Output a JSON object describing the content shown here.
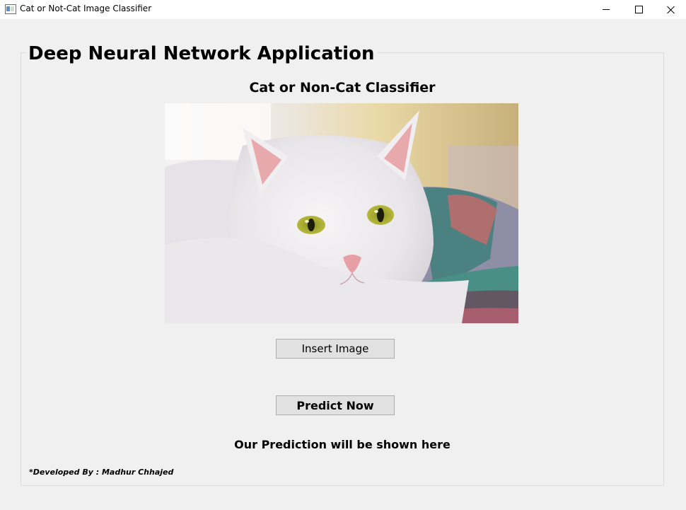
{
  "window": {
    "title": "Cat or Not-Cat Image Classifier",
    "icon": "app-window-icon",
    "controls": [
      "minimize-icon",
      "maximize-icon",
      "close-icon"
    ]
  },
  "group": {
    "title": "Deep Neural Network Application"
  },
  "main": {
    "subtitle": "Cat or Non-Cat Classifier",
    "image": "white cat photo",
    "insert_label": "Insert Image",
    "predict_label": "Predict Now",
    "prediction_text": "Our Prediction will be shown here"
  },
  "footer": {
    "credit": "*Developed By : Madhur Chhajed"
  }
}
